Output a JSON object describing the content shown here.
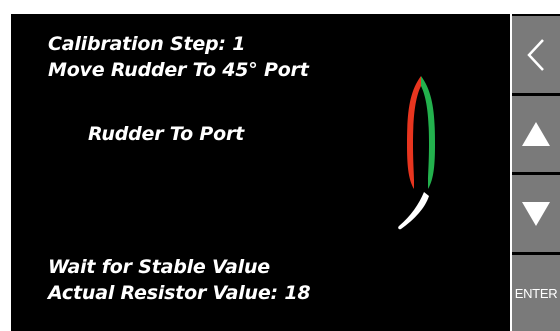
{
  "calibration": {
    "step_line": "Calibration Step: 1",
    "instruction": "Move Rudder To 45° Port",
    "rudder_status": "Rudder To Port",
    "wait_text": "Wait for Stable Value",
    "resistor_line": "Actual Resistor Value: 18"
  },
  "icons": {
    "boat": "boat-hull-icon",
    "rudder": "rudder-icon",
    "back": "chevron-left-icon",
    "up": "triangle-up-icon",
    "down": "triangle-down-icon"
  },
  "colors": {
    "port": "#e8351f",
    "starboard": "#23b14d",
    "button": "#7a7a7a",
    "screen": "#000000"
  },
  "sidebar": {
    "enter_label": "ENTER"
  }
}
